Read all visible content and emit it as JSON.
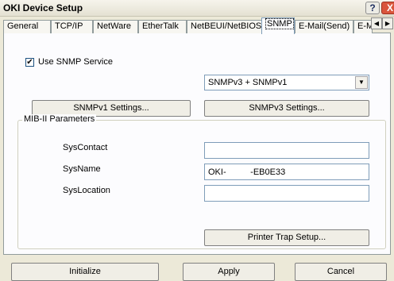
{
  "window": {
    "title": "OKI Device Setup",
    "help_label": "?",
    "close_label": "X"
  },
  "tabs": [
    {
      "label": "General"
    },
    {
      "label": "TCP/IP"
    },
    {
      "label": "NetWare"
    },
    {
      "label": "EtherTalk"
    },
    {
      "label": "NetBEUI/NetBIOS"
    },
    {
      "label": "SNMP"
    },
    {
      "label": "E-Mail(Send)"
    },
    {
      "label": "E-M"
    }
  ],
  "tab_scroll": {
    "left_icon": "chevron-left-icon",
    "right_icon": "chevron-right-icon",
    "left_glyph": "◀",
    "right_glyph": "▶"
  },
  "snmp": {
    "use_label": "Use SNMP Service",
    "use_checked": true,
    "check_glyph": "✔",
    "version_select": "SNMPv3 + SNMPv1",
    "select_arrow": "▼",
    "v1_button": "SNMPv1 Settings...",
    "v3_button": "SNMPv3 Settings..."
  },
  "mib": {
    "group_title": "MIB-II Parameters",
    "syscontact_label": "SysContact",
    "syscontact_value": "",
    "sysname_label": "SysName",
    "sysname_value": "OKI-          -EB0E33",
    "syslocation_label": "SysLocation",
    "syslocation_value": "",
    "trap_button": "Printer Trap Setup..."
  },
  "footer": {
    "initialize": "Initialize",
    "apply": "Apply",
    "cancel": "Cancel"
  }
}
